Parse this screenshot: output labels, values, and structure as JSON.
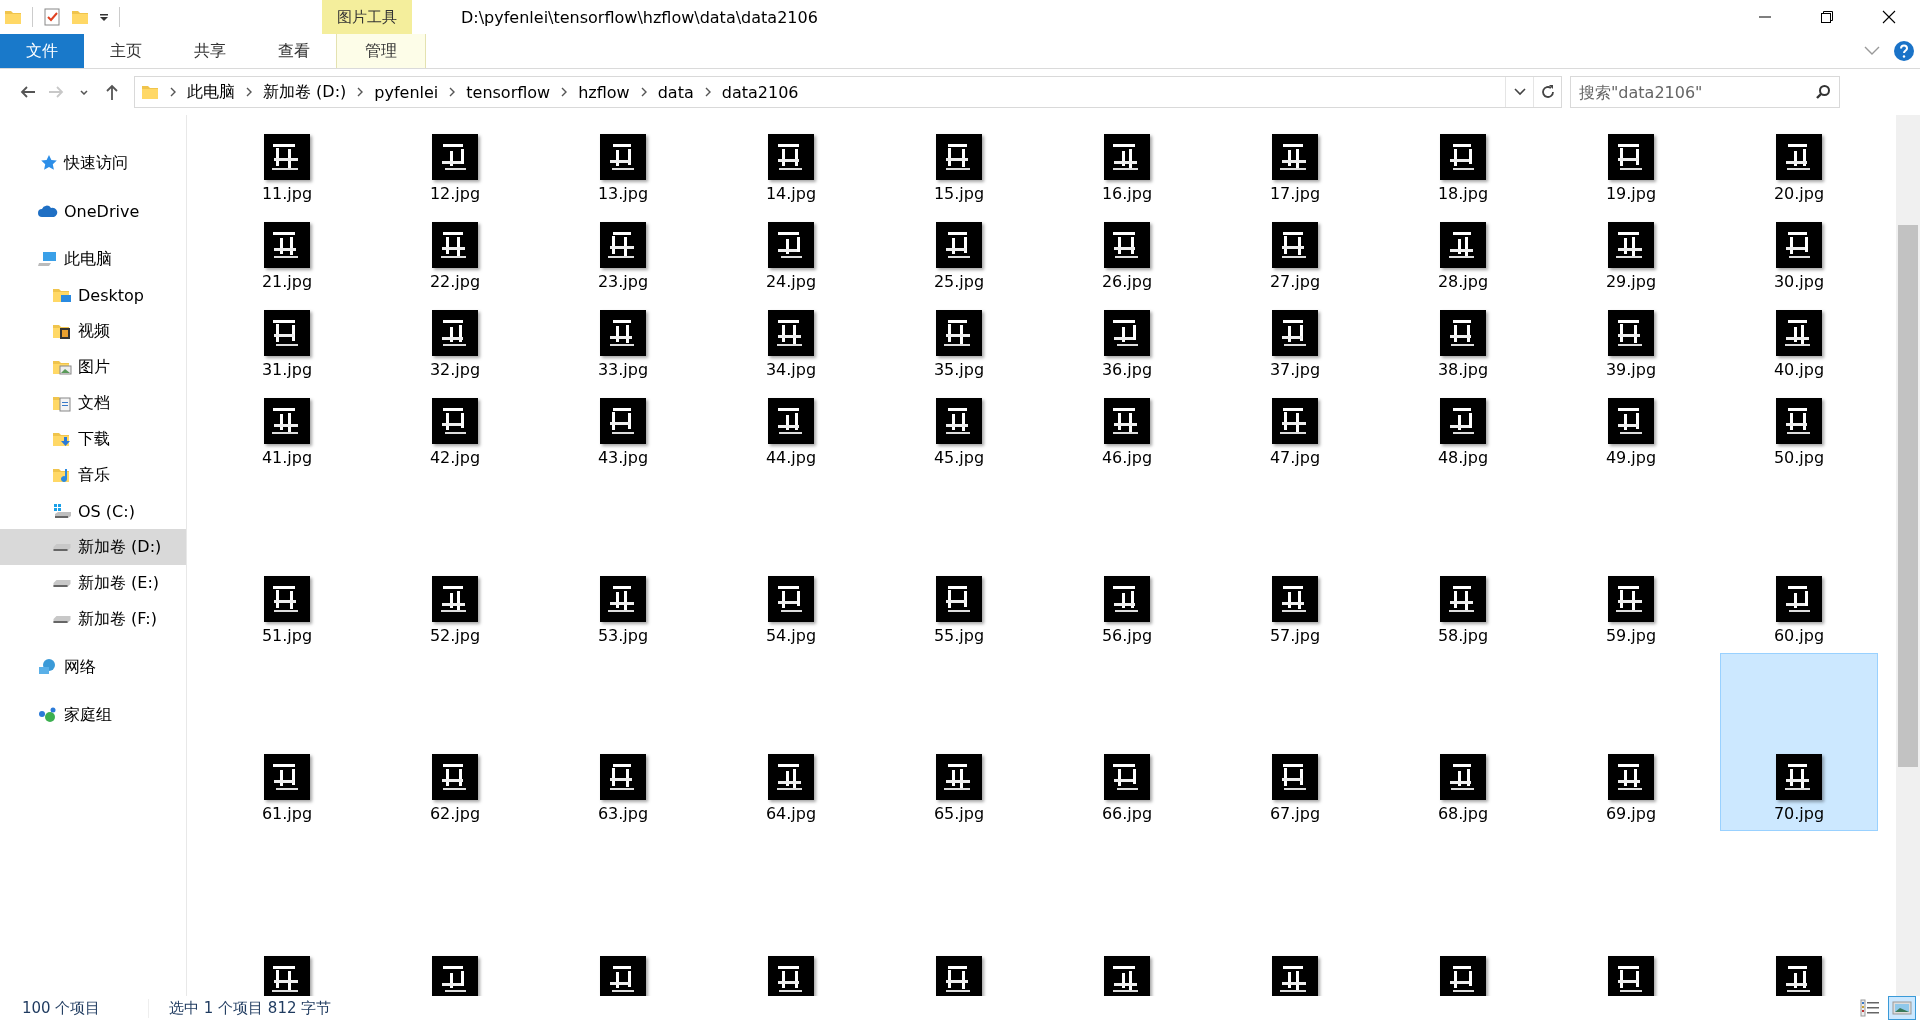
{
  "title_bar": {
    "context_label": "图片工具",
    "path": "D:\\pyfenlei\\tensorflow\\hzflow\\data\\data2106"
  },
  "ribbon_tabs": [
    {
      "label": "文件",
      "kind": "file"
    },
    {
      "label": "主页",
      "kind": "normal"
    },
    {
      "label": "共享",
      "kind": "normal"
    },
    {
      "label": "查看",
      "kind": "normal"
    },
    {
      "label": "管理",
      "kind": "contextual"
    }
  ],
  "nav_buttons": [
    {
      "kind": "back",
      "disabled": false
    },
    {
      "kind": "forward",
      "disabled": true
    },
    {
      "kind": "recent",
      "disabled": false
    },
    {
      "kind": "up",
      "disabled": false
    }
  ],
  "address_bar": {
    "segments": [
      "此电脑",
      "新加卷 (D:)",
      "pyfenlei",
      "tensorflow",
      "hzflow",
      "data",
      "data2106"
    ]
  },
  "search": {
    "placeholder": "搜索\"data2106\""
  },
  "navigation": [
    {
      "label": "快速访问",
      "kind": "quick",
      "selected": false
    },
    {
      "label": "OneDrive",
      "kind": "cloud",
      "selected": false
    },
    {
      "label": "此电脑",
      "kind": "pc",
      "selected": false,
      "children": [
        {
          "label": "Desktop",
          "kind": "desktop",
          "selected": false
        },
        {
          "label": "视频",
          "kind": "videos",
          "selected": false
        },
        {
          "label": "图片",
          "kind": "pictures",
          "selected": false
        },
        {
          "label": "文档",
          "kind": "documents",
          "selected": false
        },
        {
          "label": "下载",
          "kind": "downloads",
          "selected": false
        },
        {
          "label": "音乐",
          "kind": "music",
          "selected": false
        },
        {
          "label": "OS (C:)",
          "kind": "system-drive",
          "selected": false
        },
        {
          "label": "新加卷 (D:)",
          "kind": "drive",
          "selected": true
        },
        {
          "label": "新加卷 (E:)",
          "kind": "drive",
          "selected": false
        },
        {
          "label": "新加卷 (F:)",
          "kind": "drive",
          "selected": false
        }
      ]
    },
    {
      "label": "网络",
      "kind": "network",
      "selected": false
    },
    {
      "label": "家庭组",
      "kind": "homegroup",
      "selected": false
    }
  ],
  "files": {
    "rows": [
      {
        "items": [
          {
            "name": "11.jpg",
            "selected": false
          },
          {
            "name": "12.jpg",
            "selected": false
          },
          {
            "name": "13.jpg",
            "selected": false
          },
          {
            "name": "14.jpg",
            "selected": false
          },
          {
            "name": "15.jpg",
            "selected": false
          },
          {
            "name": "16.jpg",
            "selected": false
          },
          {
            "name": "17.jpg",
            "selected": false
          },
          {
            "name": "18.jpg",
            "selected": false
          },
          {
            "name": "19.jpg",
            "selected": false
          },
          {
            "name": "20.jpg",
            "selected": false
          }
        ]
      },
      {
        "items": [
          {
            "name": "21.jpg",
            "selected": false
          },
          {
            "name": "22.jpg",
            "selected": false
          },
          {
            "name": "23.jpg",
            "selected": false
          },
          {
            "name": "24.jpg",
            "selected": false
          },
          {
            "name": "25.jpg",
            "selected": false
          },
          {
            "name": "26.jpg",
            "selected": false
          },
          {
            "name": "27.jpg",
            "selected": false
          },
          {
            "name": "28.jpg",
            "selected": false
          },
          {
            "name": "29.jpg",
            "selected": false
          },
          {
            "name": "30.jpg",
            "selected": false
          }
        ]
      },
      {
        "items": [
          {
            "name": "31.jpg",
            "selected": false
          },
          {
            "name": "32.jpg",
            "selected": false
          },
          {
            "name": "33.jpg",
            "selected": false
          },
          {
            "name": "34.jpg",
            "selected": false
          },
          {
            "name": "35.jpg",
            "selected": false
          },
          {
            "name": "36.jpg",
            "selected": false
          },
          {
            "name": "37.jpg",
            "selected": false
          },
          {
            "name": "38.jpg",
            "selected": false
          },
          {
            "name": "39.jpg",
            "selected": false
          },
          {
            "name": "40.jpg",
            "selected": false
          }
        ]
      },
      {
        "items": [
          {
            "name": "41.jpg",
            "selected": false
          },
          {
            "name": "42.jpg",
            "selected": false
          },
          {
            "name": "43.jpg",
            "selected": false
          },
          {
            "name": "44.jpg",
            "selected": false
          },
          {
            "name": "45.jpg",
            "selected": false
          },
          {
            "name": "46.jpg",
            "selected": false
          },
          {
            "name": "47.jpg",
            "selected": false
          },
          {
            "name": "48.jpg",
            "selected": false
          },
          {
            "name": "49.jpg",
            "selected": false
          },
          {
            "name": "50.jpg",
            "selected": false
          }
        ]
      },
      {
        "items": [
          {
            "name": "51.jpg",
            "selected": false
          },
          {
            "name": "52.jpg",
            "selected": false
          },
          {
            "name": "53.jpg",
            "selected": false
          },
          {
            "name": "54.jpg",
            "selected": false
          },
          {
            "name": "55.jpg",
            "selected": false
          },
          {
            "name": "56.jpg",
            "selected": false
          },
          {
            "name": "57.jpg",
            "selected": false
          },
          {
            "name": "58.jpg",
            "selected": false
          },
          {
            "name": "59.jpg",
            "selected": false
          },
          {
            "name": "60.jpg",
            "selected": false
          }
        ]
      },
      {
        "items": [
          {
            "name": "61.jpg",
            "selected": false
          },
          {
            "name": "62.jpg",
            "selected": false
          },
          {
            "name": "63.jpg",
            "selected": false
          },
          {
            "name": "64.jpg",
            "selected": false
          },
          {
            "name": "65.jpg",
            "selected": false
          },
          {
            "name": "66.jpg",
            "selected": false
          },
          {
            "name": "67.jpg",
            "selected": false
          },
          {
            "name": "68.jpg",
            "selected": false
          },
          {
            "name": "69.jpg",
            "selected": false
          },
          {
            "name": "70.jpg",
            "selected": true
          }
        ]
      },
      {
        "items": [
          {
            "selected": false
          },
          {
            "selected": false
          },
          {
            "selected": false
          },
          {
            "selected": false
          },
          {
            "selected": false
          },
          {
            "selected": false
          },
          {
            "selected": false
          },
          {
            "selected": false
          },
          {
            "selected": false
          },
          {
            "selected": false
          }
        ]
      }
    ]
  },
  "status_bar": {
    "count": "100 个项目",
    "selection": "选中 1 个项目  812 字节"
  },
  "view_buttons": [
    {
      "kind": "details",
      "selected": false
    },
    {
      "kind": "large-icons",
      "selected": true
    }
  ]
}
